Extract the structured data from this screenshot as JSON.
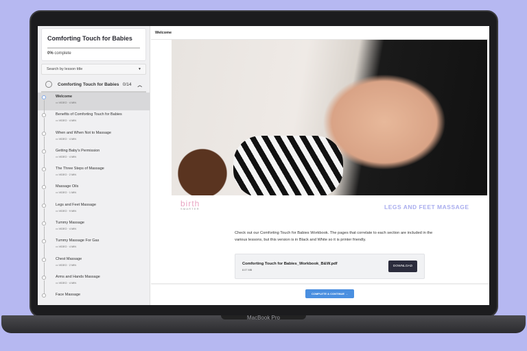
{
  "device": {
    "brand": "MacBook Pro"
  },
  "sidebar": {
    "course_title": "Comforting Touch for Babies",
    "progress_percent": 0,
    "progress_pct_label": "0%",
    "progress_label": "complete",
    "search_placeholder": "Search by lesson title",
    "section": {
      "title": "Comforting Touch for Babies",
      "count": "0/14"
    },
    "lessons": [
      {
        "title": "Welcome",
        "meta": "VIDEO · 4 MIN",
        "active": true
      },
      {
        "title": "Benefits of Comforting Touch for Babies",
        "meta": "VIDEO · 4 MIN"
      },
      {
        "title": "When and When Not to Massage",
        "meta": "VIDEO · 4 MIN"
      },
      {
        "title": "Getting Baby's Permission",
        "meta": "VIDEO · 4 MIN"
      },
      {
        "title": "The Three Steps of Massage",
        "meta": "VIDEO · 2 MIN"
      },
      {
        "title": "Massage Oils",
        "meta": "VIDEO · 1 MIN"
      },
      {
        "title": "Legs and Feet Massage",
        "meta": "VIDEO · 9 MIN"
      },
      {
        "title": "Tummy Massage",
        "meta": "VIDEO · 4 MIN"
      },
      {
        "title": "Tummy Massage For Gas",
        "meta": "VIDEO · 4 MIN"
      },
      {
        "title": "Chest Massage",
        "meta": "VIDEO · 2 MIN"
      },
      {
        "title": "Arms and Hands Massage",
        "meta": "VIDEO · 4 MIN"
      },
      {
        "title": "Face Massage",
        "meta": ""
      }
    ]
  },
  "main": {
    "header": "Welcome",
    "logo": {
      "line1": "birth",
      "line2": "SMARTER"
    },
    "video_caption": "LEGS AND FEET MASSAGE",
    "description": "Check out our Comforting Touch for Babies Workbook. The pages that correlate to each section are included in the various lessons, but this version is in Black and White so it is printer friendly.",
    "file": {
      "name": "Comforting Touch for Babies_Workbook_B&W.pdf",
      "size": "8.07 MB",
      "download_label": "DOWNLOAD"
    },
    "complete_label": "COMPLETE & CONTINUE →"
  },
  "colors": {
    "accent": "#4a8fe0",
    "caption": "#a9adee",
    "download": "#2b2c3c",
    "background": "#b6b8f1"
  }
}
